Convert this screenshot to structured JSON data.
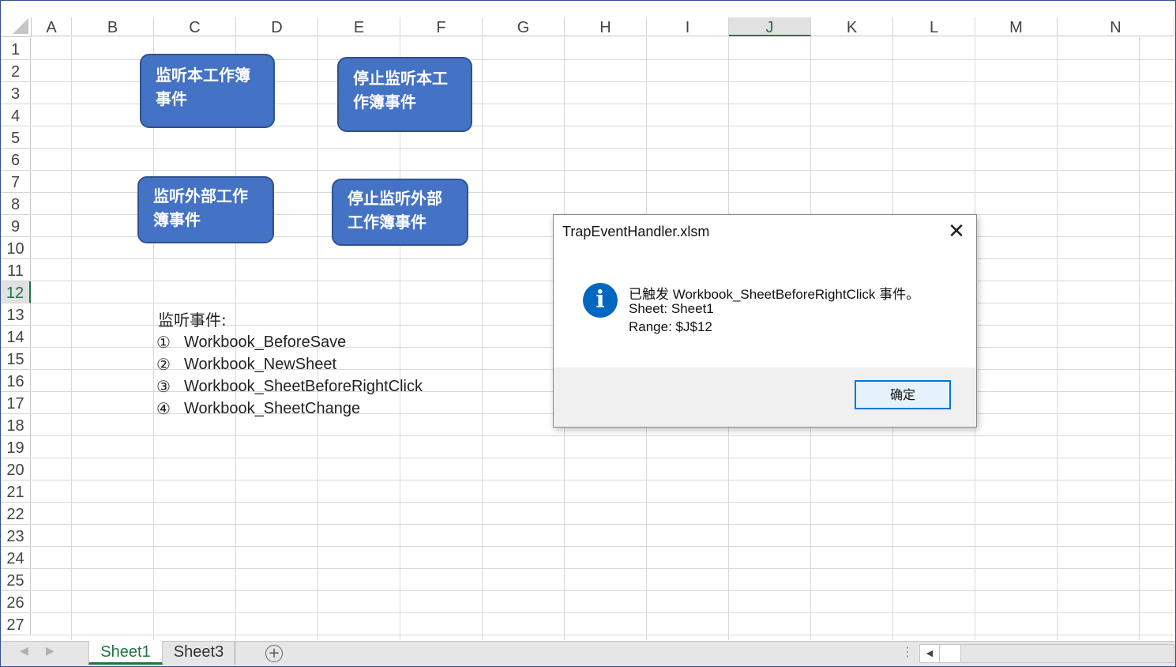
{
  "sheet": {
    "columns": [
      "A",
      "B",
      "C",
      "D",
      "E",
      "F",
      "G",
      "H",
      "I",
      "J",
      "K",
      "L",
      "M",
      "N"
    ],
    "selected_column": "J",
    "rows": [
      "1",
      "2",
      "3",
      "4",
      "5",
      "6",
      "7",
      "8",
      "9",
      "10",
      "11",
      "12",
      "13",
      "14",
      "15",
      "16",
      "17",
      "18",
      "19",
      "20",
      "21",
      "22",
      "23",
      "24",
      "25",
      "26",
      "27"
    ],
    "selected_row": "12"
  },
  "buttons": {
    "listen_this": "监听本工作簿事件",
    "stop_this": "停止监听本工作簿事件",
    "listen_external": "监听外部工作簿事件",
    "stop_external": "停止监听外部工作簿事件"
  },
  "cells": {
    "heading": "监听事件:",
    "events": [
      {
        "num": "①",
        "name": "Workbook_BeforeSave"
      },
      {
        "num": "②",
        "name": "Workbook_NewSheet"
      },
      {
        "num": "③",
        "name": "Workbook_SheetBeforeRightClick"
      },
      {
        "num": "④",
        "name": "Workbook_SheetChange"
      }
    ]
  },
  "dialog": {
    "title": "TrapEventHandler.xlsm",
    "close_symbol": "✕",
    "icon": "info-icon",
    "icon_glyph": "i",
    "message_lines": [
      "已触发 Workbook_SheetBeforeRightClick 事件。",
      "Sheet: Sheet1",
      "Range: $J$12"
    ],
    "ok_label": "确定"
  },
  "tabs": {
    "items": [
      "Sheet1",
      "Sheet3"
    ],
    "active": "Sheet1",
    "add_symbol": "+"
  },
  "colors": {
    "button_fill": "#4472c4",
    "button_border": "#2f528f",
    "excel_green": "#217346",
    "dialog_accent": "#0078d7"
  }
}
